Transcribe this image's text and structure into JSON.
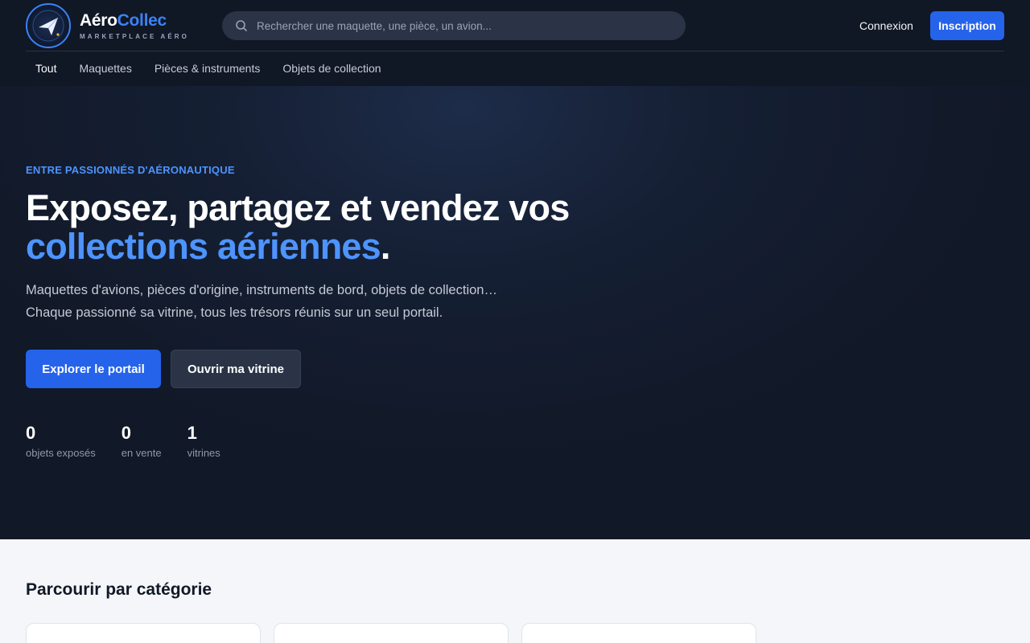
{
  "brand": {
    "name_part1": "Aéro",
    "name_part2": "Collec",
    "tagline": "MARKETPLACE AÉRO"
  },
  "search": {
    "placeholder": "Rechercher une maquette, une pièce, un avion..."
  },
  "header": {
    "login_label": "Connexion",
    "signup_label": "Inscription"
  },
  "nav": {
    "tabs": [
      {
        "label": "Tout",
        "active": true
      },
      {
        "label": "Maquettes",
        "active": false
      },
      {
        "label": "Pièces & instruments",
        "active": false
      },
      {
        "label": "Objets de collection",
        "active": false
      }
    ]
  },
  "hero": {
    "eyebrow": "ENTRE PASSIONNÉS D'AÉRONAUTIQUE",
    "headline_line1": "Exposez, partagez et vendez vos",
    "headline_highlight": "collections aériennes",
    "headline_end": ".",
    "lead_line1": "Maquettes d'avions, pièces d'origine, instruments de bord, objets de collection…",
    "lead_line2": "Chaque passionné sa vitrine, tous les trésors réunis sur un seul portail.",
    "cta_primary": "Explorer le portail",
    "cta_secondary": "Ouvrir ma vitrine",
    "stats": [
      {
        "value": "0",
        "label": "objets exposés"
      },
      {
        "value": "0",
        "label": "en vente"
      },
      {
        "value": "1",
        "label": "vitrines"
      }
    ]
  },
  "categories": {
    "title": "Parcourir par catégorie"
  },
  "colors": {
    "accent": "#2563eb",
    "highlight": "#4d94ff",
    "header_bg": "#101725",
    "hero_bg": "#151f33",
    "page_bg": "#f4f6f9"
  },
  "icons": {
    "logo": "plane-logo-icon",
    "search": "search-icon"
  }
}
